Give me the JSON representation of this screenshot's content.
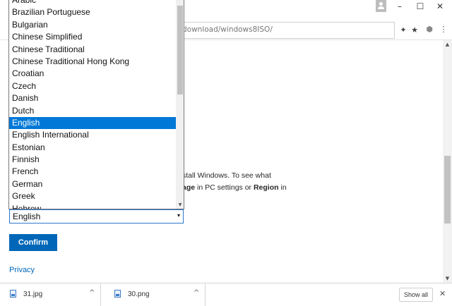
{
  "window": {
    "minimize": "–",
    "maximize": "☐",
    "close": "✕"
  },
  "toolbar": {
    "url": "download/windows8ISO/",
    "extension_icon": "puzzle-icon",
    "star_icon": "★",
    "cube_icon": "⬢",
    "menu_icon": "⋮"
  },
  "dropdown": {
    "items": [
      "Arabic",
      "Brazilian Portuguese",
      "Bulgarian",
      "Chinese Simplified",
      "Chinese Traditional",
      "Chinese Traditional Hong Kong",
      "Croatian",
      "Czech",
      "Danish",
      "Dutch",
      "English",
      "English International",
      "Estonian",
      "Finnish",
      "French",
      "German",
      "Greek",
      "Hebrew"
    ],
    "selected_index": 10
  },
  "content": {
    "desc_line1": "stall Windows. To see what",
    "desc_bold1": "age",
    "desc_mid": " in PC settings or ",
    "desc_bold2": "Region",
    "desc_end": " in"
  },
  "form": {
    "select_value": "English",
    "select_arrow": "▾",
    "confirm_label": "Confirm",
    "privacy_label": "Privacy"
  },
  "downloads": {
    "items": [
      {
        "name": "31.jpg"
      },
      {
        "name": "30.png"
      }
    ],
    "chevron": "^",
    "show_all_label": "Show all",
    "close": "✕"
  },
  "colors": {
    "accent": "#0067b8",
    "selection": "#0078d7"
  }
}
